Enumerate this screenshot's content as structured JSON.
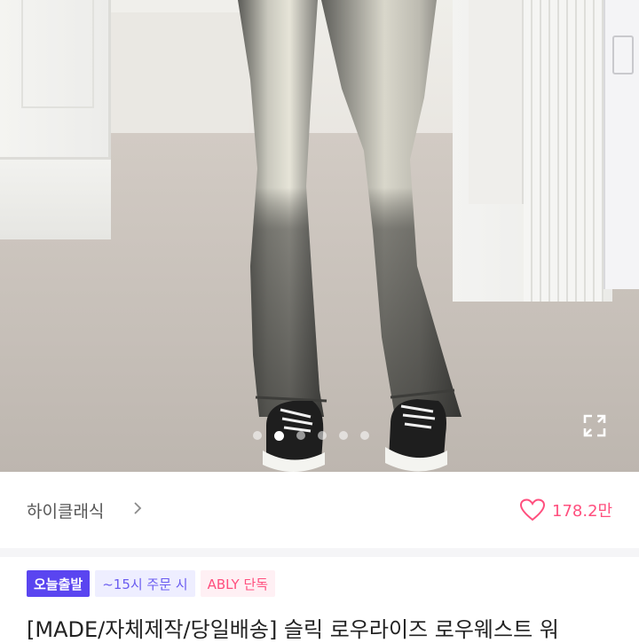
{
  "product_image": {
    "alt_icon": "product-photo",
    "carousel": {
      "total": 6,
      "active": 2
    },
    "expand_icon": "expand-icon"
  },
  "shop": {
    "name": "하이클래식",
    "chevron_icon": "chevron-right-icon",
    "like_icon": "heart-outline-icon",
    "like_count": "178.2만"
  },
  "badges": [
    {
      "label": "오늘출발",
      "kind": "delivery"
    },
    {
      "label": "~15시 주문 시",
      "kind": "cutoff"
    },
    {
      "label": "ABLY 단독",
      "kind": "exclusive"
    }
  ],
  "product": {
    "title": "[MADE/자체제작/당일배송] 슬릭 로우라이즈 로우웨스트 워"
  },
  "colors": {
    "accent_purple": "#5a45f0",
    "accent_pink": "#ff4f7e"
  }
}
